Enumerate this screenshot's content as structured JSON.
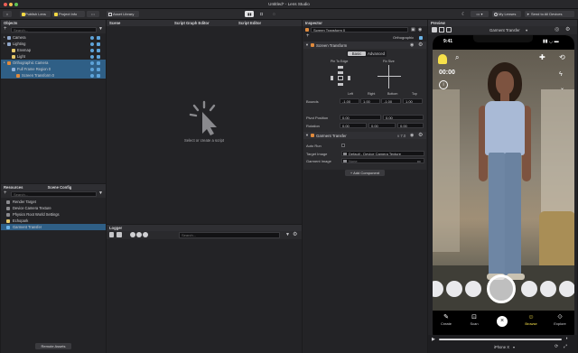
{
  "window": {
    "title": "Untitled* - Lens Studio"
  },
  "toolbar": {
    "publish_lens": "Publish Lens",
    "project_info": "Project Info",
    "asset_library": "Asset Library",
    "my_lenses": "My Lenses",
    "send_to_devices": "Send to All Devices"
  },
  "objects": {
    "title": "Objects",
    "search_placeholder": "Search...",
    "items": [
      {
        "label": "Camera",
        "depth": 0,
        "color": "#8fa6c9",
        "selected": false
      },
      {
        "label": "Lighting",
        "depth": 0,
        "color": "#8fa6c9",
        "selected": false
      },
      {
        "label": "Envmap",
        "depth": 1,
        "color": "#e5c86a",
        "selected": false
      },
      {
        "label": "Light",
        "depth": 1,
        "color": "#e5c86a",
        "selected": false
      },
      {
        "label": "Orthographic Camera",
        "depth": 0,
        "color": "#e08a3c",
        "selected": true
      },
      {
        "label": "Full Frame Region 0",
        "depth": 1,
        "color": "#8fb0d8",
        "selected": true
      },
      {
        "label": "Screen Transform 0",
        "depth": 2,
        "color": "#e08a3c",
        "selected": true
      }
    ]
  },
  "resources": {
    "tab_resources": "Resources",
    "tab_scene_config": "Scene Config",
    "search_placeholder": "Search...",
    "items": [
      {
        "label": "Render Target",
        "color": "#8a8a8e",
        "selected": false
      },
      {
        "label": "Device Camera Texture",
        "color": "#8a8a8e",
        "selected": false
      },
      {
        "label": "Physics Root World Settings",
        "color": "#8a8a8e",
        "selected": false
      },
      {
        "label": "Echopark",
        "color": "#e5c86a",
        "selected": false
      },
      {
        "label": "Garment Transfer",
        "color": "#6cb4e8",
        "selected": true
      }
    ],
    "remote_assets": "Remote Assets"
  },
  "scene": {
    "title": "Scene",
    "script_graph_editor": "Script Graph Editor",
    "script_editor": "Script Editor",
    "empty_text": "Select or create a script"
  },
  "logger": {
    "title": "Logger",
    "search_placeholder": "Search..."
  },
  "inspector": {
    "title": "Inspector",
    "object_name": "Screen Transform 0",
    "layer": "Orthographic",
    "screen_transform": {
      "title": "Screen Transform",
      "tab_basic": "Basic",
      "tab_advanced": "Advanced",
      "pin_to_edge": "Pin To Edge",
      "fix_size": "Fix Size",
      "col_left": "Left",
      "col_right": "Right",
      "col_bottom": "Bottom",
      "col_top": "Top",
      "bounds_label": "Bounds",
      "bounds": [
        "-1.00",
        "1.00",
        "-1.00",
        "1.00"
      ],
      "pivot_label": "Pivot Position",
      "pivot": [
        "0.00",
        "0.00"
      ],
      "rotation_label": "Rotation",
      "rotation": [
        "0.00",
        "0.00",
        "0.00"
      ]
    },
    "garment_transfer": {
      "title": "Garment Transfer",
      "version": "v 7.0",
      "auto_run": "Auto Run",
      "target_image_label": "Target Image",
      "target_image_value": "Default - Device Camera Texture",
      "garment_image_label": "Garment Image",
      "garment_image_value": "None"
    },
    "add_component": "+ Add Component"
  },
  "preview": {
    "title": "Preview",
    "lens_name": "Garment Transfer",
    "timer": "00:00",
    "status_time": "9:41",
    "nav": [
      "Create",
      "Scan",
      "Browse",
      "Explore"
    ],
    "device": "iPhone X"
  }
}
